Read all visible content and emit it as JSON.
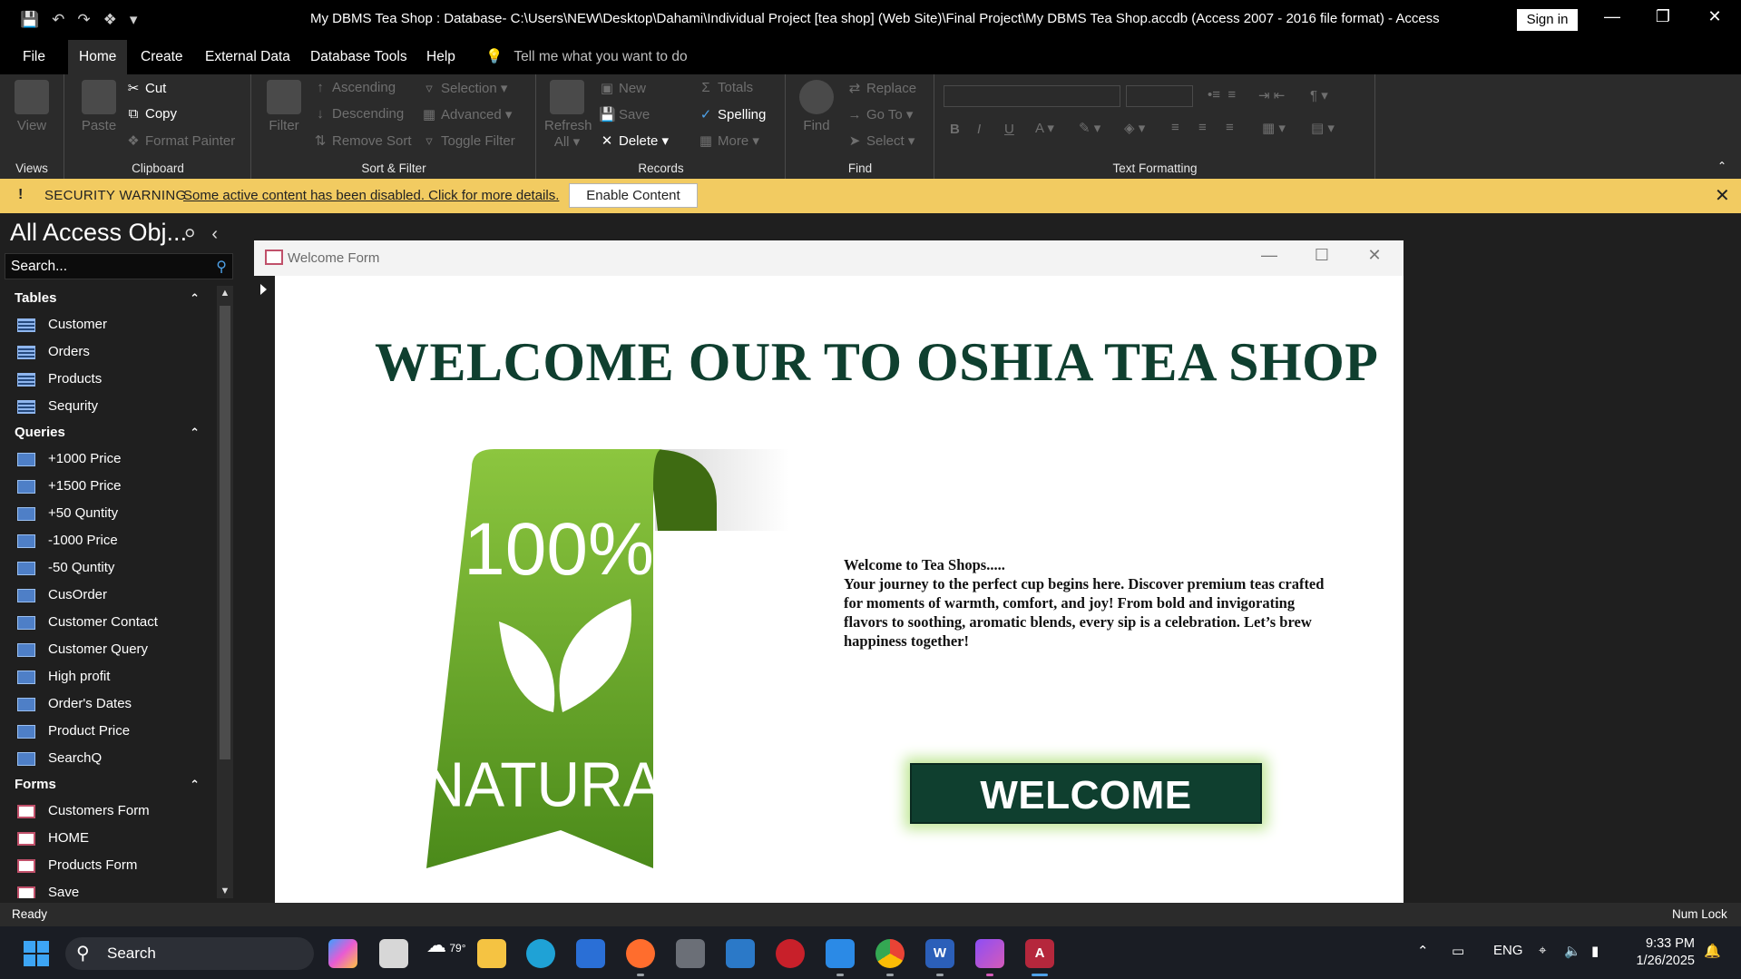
{
  "window": {
    "title": "My DBMS Tea Shop : Database- C:\\Users\\NEW\\Desktop\\Dahami\\Individual Project [tea shop] (Web Site)\\Final Project\\My DBMS Tea Shop.accdb (Access 2007 - 2016 file format)  -  Access",
    "sign_in": "Sign in"
  },
  "menu": {
    "tabs": [
      "File",
      "Home",
      "Create",
      "External Data",
      "Database Tools",
      "Help"
    ],
    "active": "Home",
    "tell_me": "Tell me what you want to do"
  },
  "ribbon": {
    "views": {
      "label": "Views",
      "view": "View"
    },
    "clipboard": {
      "label": "Clipboard",
      "paste": "Paste",
      "cut": "Cut",
      "copy": "Copy",
      "format_painter": "Format Painter"
    },
    "sort_filter": {
      "label": "Sort & Filter",
      "filter": "Filter",
      "ascending": "Ascending",
      "descending": "Descending",
      "remove_sort": "Remove Sort",
      "selection": "Selection",
      "advanced": "Advanced",
      "toggle_filter": "Toggle Filter"
    },
    "records": {
      "label": "Records",
      "refresh": "Refresh",
      "refresh_all": "All",
      "new": "New",
      "save": "Save",
      "delete": "Delete",
      "totals": "Totals",
      "spelling": "Spelling",
      "more": "More"
    },
    "find": {
      "label": "Find",
      "find": "Find",
      "replace": "Replace",
      "goto": "Go To",
      "select": "Select"
    },
    "text_formatting": {
      "label": "Text Formatting"
    }
  },
  "security": {
    "icon": "!",
    "label": "SECURITY WARNING",
    "message": "Some active content has been disabled. Click for more details.",
    "button": "Enable Content"
  },
  "nav": {
    "title": "All Access Obj...",
    "search_placeholder": "Search...",
    "sections": [
      {
        "name": "Tables",
        "type": "table",
        "items": [
          "Customer",
          "Orders",
          "Products",
          "Sequrity"
        ]
      },
      {
        "name": "Queries",
        "type": "query",
        "items": [
          "+1000 Price",
          "+1500 Price",
          "+50 Quntity",
          "-1000 Price",
          "-50 Quntity",
          "CusOrder",
          "Customer Contact",
          "Customer Query",
          "High profit",
          "Order's Dates",
          "Product Price",
          "SearchQ"
        ]
      },
      {
        "name": "Forms",
        "type": "form",
        "items": [
          "Customers Form",
          "HOME",
          "Products Form",
          "Save"
        ]
      }
    ]
  },
  "form": {
    "title": "Welcome Form",
    "headline": "WELCOME OUR TO OSHIA TEA SHOP",
    "badge": {
      "percent": "100%",
      "word": "NATURAL"
    },
    "blurb_title": "Welcome to Tea Shops.....",
    "blurb_body": "Your journey to the perfect cup begins here. Discover premium teas crafted for moments of warmth, comfort, and joy! From bold and invigorating flavors to soothing, aromatic blends, every sip is a celebration. Let’s brew happiness together!",
    "button": "WELCOME"
  },
  "status": {
    "left": "Ready",
    "right": "Num Lock"
  },
  "taskbar": {
    "search": "Search",
    "weather": "79°",
    "lang": "ENG",
    "time": "9:33 PM",
    "date": "1/26/2025"
  },
  "colors": {
    "accent_green": "#0f3f2f",
    "security_bar": "#f2cb61",
    "badge_green": "#6aa32a"
  }
}
